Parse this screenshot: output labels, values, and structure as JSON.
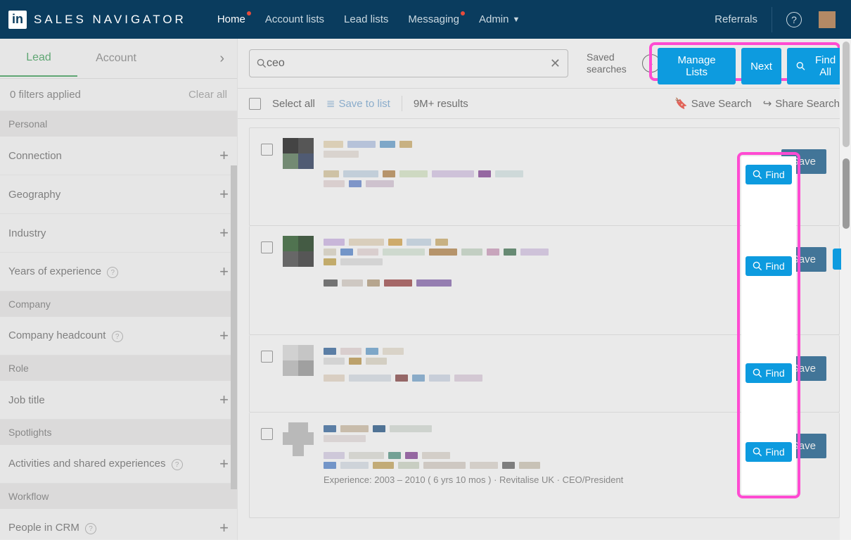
{
  "brand": "SALES NAVIGATOR",
  "nav": {
    "home": "Home",
    "account_lists": "Account lists",
    "lead_lists": "Lead lists",
    "messaging": "Messaging",
    "admin": "Admin",
    "referrals": "Referrals"
  },
  "tabs": {
    "lead": "Lead",
    "account": "Account"
  },
  "filters_applied": "0 filters applied",
  "clear_all": "Clear all",
  "sections": {
    "personal": "Personal",
    "company": "Company",
    "role": "Role",
    "spotlights": "Spotlights",
    "workflow": "Workflow"
  },
  "filters": {
    "connection": "Connection",
    "geography": "Geography",
    "industry": "Industry",
    "yoe": "Years of experience",
    "headcount": "Company headcount",
    "job_title": "Job title",
    "activities": "Activities and shared experiences",
    "crm": "People in CRM"
  },
  "search": {
    "value": "ceo",
    "placeholder": ""
  },
  "saved_searches": "Saved\nsearches",
  "ext": {
    "manage": "Manage Lists",
    "next": "Next",
    "find_all": "Find All",
    "find": "Find"
  },
  "toolbar": {
    "select_all": "Select all",
    "save_to_list": "Save to list",
    "results": "9M+ results",
    "save_search": "Save Search",
    "share_search": "Share Search"
  },
  "save_btn": "Save",
  "experience_line": "Experience: 2003 – 2010  ( 6 yrs 10 mos ) · Revitalise UK · CEO/President"
}
